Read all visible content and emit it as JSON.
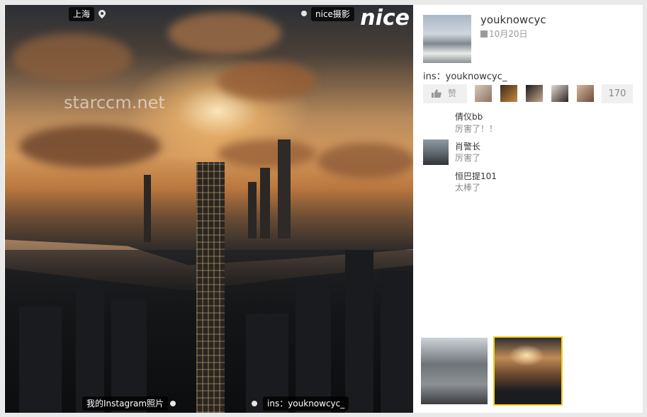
{
  "photo": {
    "watermark": "starccm.net",
    "location_tag": "上海",
    "brand_tag": "nice摄影",
    "brand_logo": "nice",
    "bottom_left_tag": "我的Instagram照片",
    "bottom_right_tag": "ins：youknowcyc_"
  },
  "post": {
    "username": "youknowcyc",
    "date": "10月20日",
    "caption": "ins：youknowcyc_",
    "like_label": "赞",
    "like_count": "170"
  },
  "comments": [
    {
      "name": "倩仪bb",
      "text": "厉害了！！"
    },
    {
      "name": "肖警长",
      "text": "厉害了"
    },
    {
      "name": "恒巴提101",
      "text": "太棒了"
    }
  ],
  "colors": {
    "selected_thumb_border": "#f2d21b",
    "background": "#e9e9e9"
  }
}
